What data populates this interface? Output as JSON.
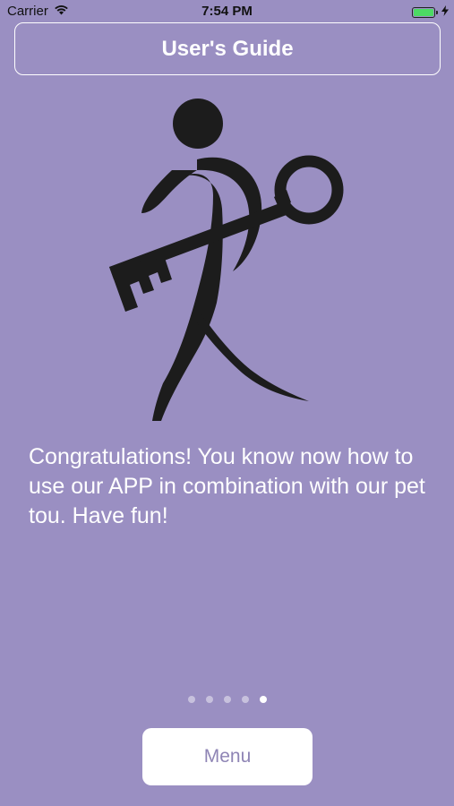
{
  "status_bar": {
    "carrier": "Carrier",
    "time": "7:54 PM",
    "battery_level": 1.0,
    "battery_color": "#4cd964"
  },
  "header": {
    "title": "User's Guide"
  },
  "logo": {
    "icon": "person-with-key-logo"
  },
  "message": {
    "text": "Congratulations! You know now how to use our APP in combination with our pet tou. Have fun!"
  },
  "pager": {
    "total_pages": 5,
    "current_page": 5
  },
  "menu_button": {
    "label": "Menu"
  },
  "colors": {
    "background": "#9a8fc2",
    "button_text": "#8f85b5"
  }
}
